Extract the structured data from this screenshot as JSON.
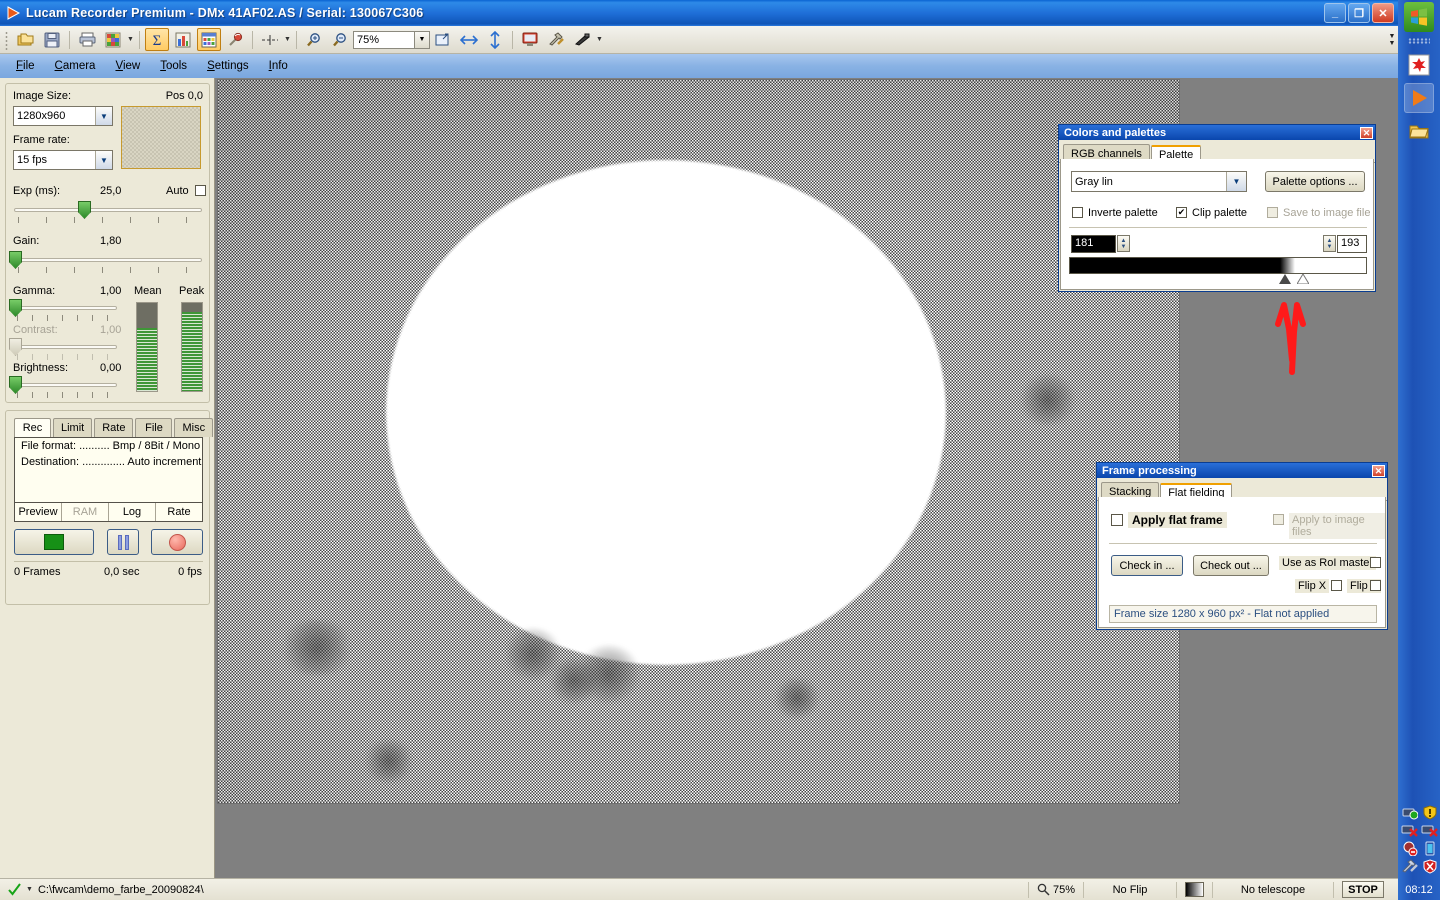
{
  "window": {
    "title": "Lucam Recorder Premium - DMx 41AF02.AS / Serial: 130067C306",
    "minimize_label": "_",
    "maximize_label": "❐",
    "close_label": "✕"
  },
  "toolbar": {
    "zoom_value": "75%",
    "items": [
      {
        "name": "open-folder",
        "label": "open"
      },
      {
        "name": "save",
        "label": "save"
      },
      {
        "name": "print",
        "label": "print"
      },
      {
        "name": "color-grid",
        "label": "colors"
      },
      {
        "name": "sigma-sum",
        "label": "Σ"
      },
      {
        "name": "histogram",
        "label": "histogram"
      },
      {
        "name": "palette-table",
        "label": "palette"
      },
      {
        "name": "eyedropper",
        "label": "pick"
      },
      {
        "name": "crosshair",
        "label": "crosshair"
      },
      {
        "name": "zoom-in",
        "label": "zoom in"
      },
      {
        "name": "zoom-out",
        "label": "zoom out"
      },
      {
        "name": "fit-window",
        "label": "fit"
      },
      {
        "name": "flip-horizontal",
        "label": "flip x"
      },
      {
        "name": "flip-vertical",
        "label": "flip y"
      },
      {
        "name": "monitor",
        "label": "monitor"
      },
      {
        "name": "tools",
        "label": "tools"
      },
      {
        "name": "telescope",
        "label": "telescope"
      }
    ]
  },
  "menu": {
    "items": [
      {
        "pre": "F",
        "rest": "ile"
      },
      {
        "pre": "C",
        "rest": "amera"
      },
      {
        "pre": "V",
        "rest": "iew"
      },
      {
        "pre": "T",
        "rest": "ools"
      },
      {
        "pre": "S",
        "rest": "ettings"
      },
      {
        "pre": "I",
        "rest": "nfo"
      }
    ]
  },
  "camera_panel": {
    "image_size_label": "Image Size:",
    "image_size_value": "1280x960",
    "pos_label": "Pos 0,0",
    "frame_rate_label": "Frame rate:",
    "frame_rate_value": "15 fps",
    "exposure_label": "Exp (ms):",
    "exposure_value": "25,0",
    "auto_label": "Auto",
    "gain_label": "Gain:",
    "gain_value": "1,80",
    "gamma_label": "Gamma:",
    "gamma_value": "1,00",
    "contrast_label": "Contrast:",
    "contrast_value": "1,00",
    "brightness_label": "Brightness:",
    "brightness_value": "0,00",
    "mean_label": "Mean",
    "peak_label": "Peak",
    "mean_percent": 72,
    "peak_percent": 90
  },
  "record_panel": {
    "tabs": [
      "Rec",
      "Limit",
      "Rate",
      "File",
      "Misc"
    ],
    "selected_tab": "Rec",
    "info_lines": [
      "File format: .......... Bmp / 8Bit / Mono",
      "Destination: .............. Auto increment"
    ],
    "footer_tabs": [
      "Preview",
      "RAM",
      "Log",
      "Rate"
    ],
    "footer_disabled": "RAM",
    "status_frames": "0 Frames",
    "status_time": "0,0 sec",
    "status_fps": "0 fps"
  },
  "colors_dialog": {
    "title": "Colors and palettes",
    "close_label": "✕",
    "tabs": [
      "RGB channels",
      "Palette"
    ],
    "selected_tab": "Palette",
    "palette_value": "Gray lin",
    "palette_options_label": "Palette options ...",
    "invert_label": "Inverte palette",
    "invert_checked": false,
    "clip_label": "Clip palette",
    "clip_checked": true,
    "save_label": "Save to image file",
    "save_checked": false,
    "low_value": "181",
    "high_value": "193"
  },
  "frame_dialog": {
    "title": "Frame processing",
    "close_label": "✕",
    "tabs": [
      "Stacking",
      "Flat fielding"
    ],
    "selected_tab": "Flat fielding",
    "apply_flat_label": "Apply flat frame",
    "apply_flat_checked": false,
    "apply_files_label": "Apply to image files",
    "apply_files_checked": false,
    "check_in_label": "Check in ...",
    "check_out_label": "Check out ...",
    "roi_master_label": "Use as RoI master",
    "flip_x_label": "Flip X",
    "flip_y_label": "Flip Y",
    "status": "Frame size 1280 x 960 px² - Flat not applied"
  },
  "statusbar": {
    "path": "C:\\fwcam\\demo_farbe_20090824\\",
    "zoom": "75%",
    "flip": "No Flip",
    "telescope": "No telescope",
    "stop_label": "STOP"
  },
  "sidebar": {
    "clock": "08:12",
    "quick_launch": [
      {
        "name": "start-button",
        "label": "start"
      },
      {
        "name": "app-red-icon",
        "label": "app"
      },
      {
        "name": "media-player-icon",
        "label": "play"
      },
      {
        "name": "explorer-folder-icon",
        "label": "folder"
      }
    ],
    "tray": [
      {
        "name": "network-shield-icon"
      },
      {
        "name": "security-alert-icon"
      },
      {
        "name": "network-disconnected-icon"
      },
      {
        "name": "second-network-disconnected-icon"
      },
      {
        "name": "audio-muted-icon"
      },
      {
        "name": "battery-icon"
      },
      {
        "name": "repair-tools-icon"
      },
      {
        "name": "antivirus-alert-icon"
      }
    ]
  },
  "annotation": {
    "name": "red-up-arrow-annotation",
    "color": "#ff1a1a"
  }
}
